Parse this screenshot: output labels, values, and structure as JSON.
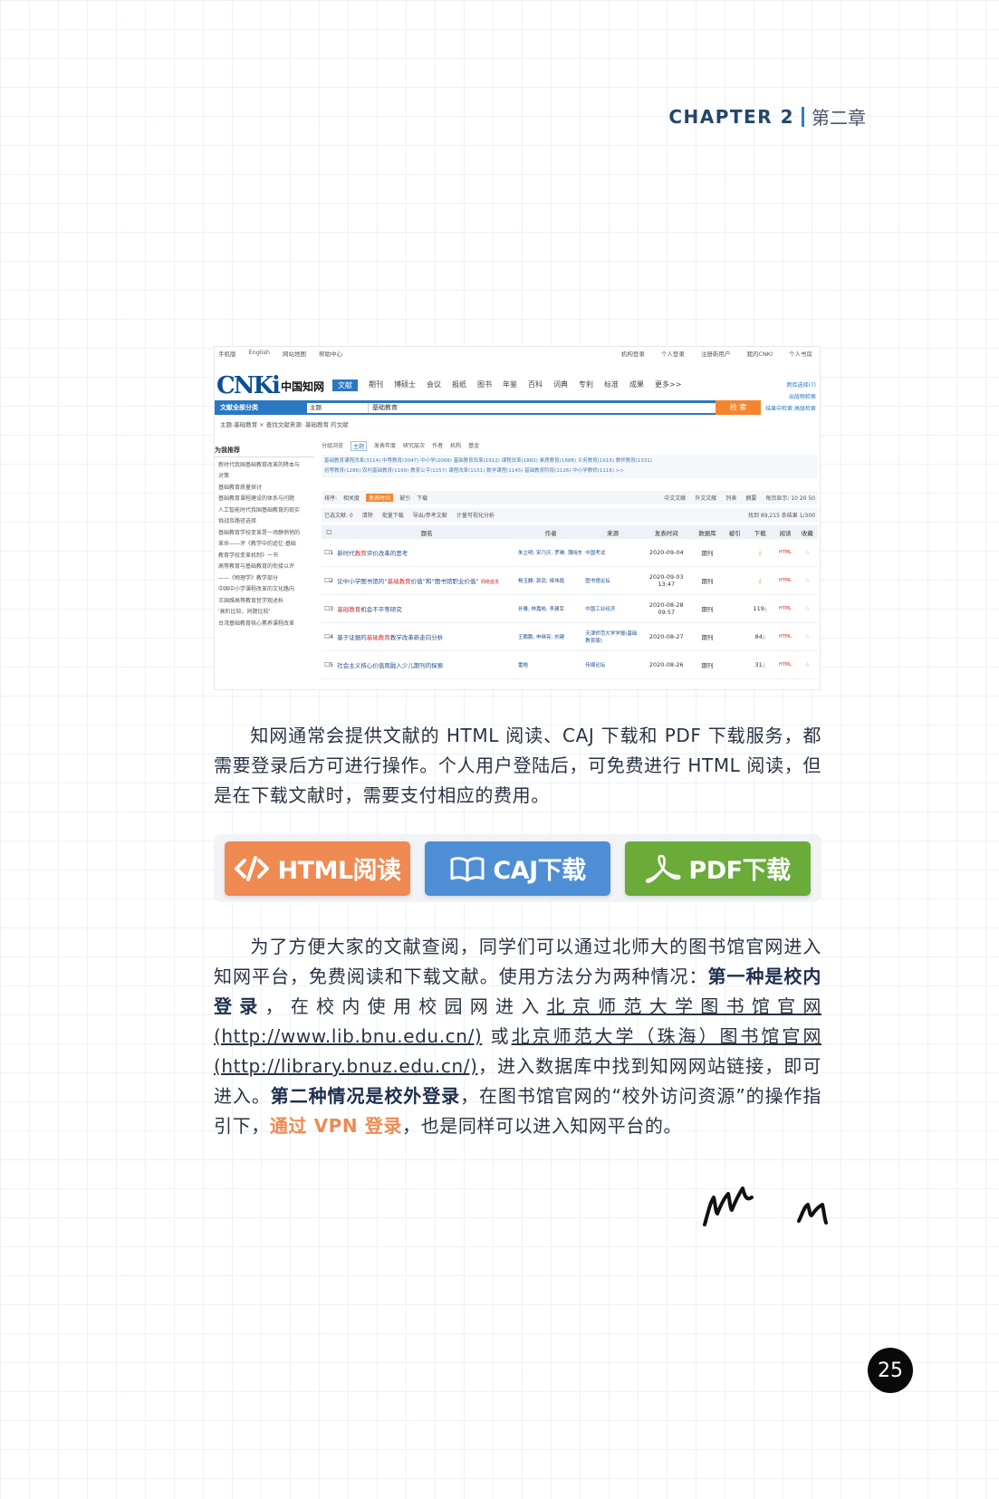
{
  "header": {
    "chapter_en": "CHAPTER 2",
    "chapter_zh": "第二章"
  },
  "screenshot": {
    "topbar_left": [
      "手机版",
      "English",
      "网站地图",
      "帮助中心"
    ],
    "topbar_right": [
      "机构登录",
      "个人登录",
      "注册新用户",
      "我的CNKI",
      "个人书房"
    ],
    "logo_text": "CNKi",
    "logo_zh": "中国知网",
    "nav": [
      "文献",
      "期刊",
      "博硕士",
      "会议",
      "报纸",
      "图书",
      "年鉴",
      "百科",
      "词典",
      "专利",
      "标准",
      "成果",
      "更多>>"
    ],
    "right_links": [
      "跨库选择(7)",
      "出版物检索",
      "结果中检索  高级检索"
    ],
    "search": {
      "category": "文献全部分类",
      "field": "主题",
      "query": "基础教育",
      "button": "检 索"
    },
    "crumb": "主题:基础教育 ×      查找文献来源: 基础教育 的文献",
    "sidebar_title": "为我推荐",
    "sidebar_items": [
      "新时代我国基础教育改革的降本与",
      "对策",
      "基础教育质量探讨",
      "基础教育课程建设的体系与问题",
      "人工智能时代我国基础教育的现实",
      "挑战及路径选择",
      "基础教育学校变革是一场静悄悄的",
      "革命——评《教学中的追忆·基础",
      "教育学校变革机制》一书",
      "高等教育与基础教育的衔接以评",
      "——《物理学》教学部分",
      "中国中小学课程改革的文化路向",
      "王国维高等教育哲学观述析",
      "'高阶比较、同题比较'",
      "台湾基础教育核心素养课程改革"
    ],
    "tabs": [
      "分组浏览",
      "主题",
      "发表年度",
      "研究层次",
      "作者",
      "机构",
      "基金"
    ],
    "subjects_line1": "基础教育课程改革(3114)   中等教育(3047)   中小学(2068)   基础教育改革(1912)   课程改革(1882)   素质教育(1888)   义务教育(1615)   教师教育(1331)",
    "subjects_line2": "初等教育(1286)   农村基础教育(1199)   教育公平(1157)   课程改革(1151)   数学课程(1145)   基础教育阶段(1126)   中小学教师(1116)   >>",
    "sort": [
      "排序:",
      "相关度",
      "发表时间",
      "被引",
      "下载"
    ],
    "sort_right": [
      "中文文献",
      "外文文献",
      "列表",
      "摘要",
      "每页显示: 10 20 50"
    ],
    "selected": [
      "已选文献: 0",
      "清除",
      "批量下载",
      "导出/参考文献",
      "计量可视化分析"
    ],
    "found": "找到 89,215 条结果   1/300",
    "columns": [
      "题名",
      "作者",
      "来源",
      "发表时间",
      "数据库",
      "被引",
      "下载",
      "阅读",
      "收藏"
    ],
    "rows": [
      {
        "n": "1",
        "title_a": "新时代",
        "hl": "教育",
        "title_b": "评价改革的思考",
        "sub": "",
        "author": "朱立明; 宋乃庆; 罗琳; 蒲晓东",
        "source": "中国考试",
        "date": "2020-09-04",
        "db": "期刊",
        "cite": "",
        "dl": "",
        "read": "HTML"
      },
      {
        "n": "2",
        "title_a": "论中小学图书馆的“",
        "hl": "基础教育",
        "title_b": "价值”和“图书馆职业价值”",
        "sub": "网络首发",
        "author": "杨玉麟; 郭武; 姬伟霞",
        "source": "图书馆论坛",
        "date": "2020-09-03 13:47",
        "db": "期刊",
        "cite": "",
        "dl": "",
        "read": "HTML"
      },
      {
        "n": "3",
        "title_a": "",
        "hl": "基础教育",
        "title_b": "机会不平等研究",
        "sub": "",
        "author": "孙雅; 林嘉彬; 李建军",
        "source": "中国工业经济",
        "date": "2020-08-28 09:57",
        "db": "期刊",
        "cite": "",
        "dl": "119",
        "read": "HTML"
      },
      {
        "n": "4",
        "title_a": "基于证据的",
        "hl": "基础教育",
        "title_b": "教学改革新走向分析",
        "sub": "",
        "author": "王鹏鹏; 申继亮; 刘建",
        "source": "天津师范大学学报(基础教育版)",
        "date": "2020-08-27",
        "db": "期刊",
        "cite": "",
        "dl": "84",
        "read": "HTML"
      },
      {
        "n": "5",
        "title_a": "社会主义核心价值观融入少儿期刊的探索",
        "hl": "",
        "title_b": "",
        "sub": "",
        "author": "雷皓",
        "source": "传媒论坛",
        "date": "2020-08-26",
        "db": "期刊",
        "cite": "",
        "dl": "31",
        "read": "HTML"
      }
    ]
  },
  "paragraph1": "知网通常会提供文献的 HTML 阅读、CAJ 下载和 PDF 下载服务，都需要登录后方可进行操作。个人用户登陆后，可免费进行 HTML 阅读，但是在下载文献时，需要支付相应的费用。",
  "buttons": {
    "html": "HTML阅读",
    "caj": "CAJ下载",
    "pdf": "PDF下载"
  },
  "paragraph2": {
    "t1": "为了方便大家的文献查阅，同学们可以通过北师大的图书馆官网进入知网平台，免费阅读和下载文献。使用方法分为两种情况：",
    "b1": "第一种是校内登录",
    "t2": "，在校内使用校园网进入",
    "u1": "北京师范大学图书馆官网(http://www.lib.bnu.edu.cn/)",
    "t3": " 或",
    "u2": "北京师范大学（珠海）图书馆官网(http://library.bnuz.edu.cn/)",
    "t4": "，进入数据库中找到知网网站链接，即可进入。",
    "b2": "第二种情况是校外登录",
    "t5": "，在图书馆官网的“校外访问资源”的操作指引下，",
    "o1": "通过 VPN 登录",
    "t6": "，也是同样可以进入知网平台的。"
  },
  "page_number": "25",
  "colors": {
    "html_button": "#ee8a52",
    "caj_button": "#4e8ed4",
    "pdf_button": "#6aab3a",
    "chapter_text": "#24456b"
  }
}
